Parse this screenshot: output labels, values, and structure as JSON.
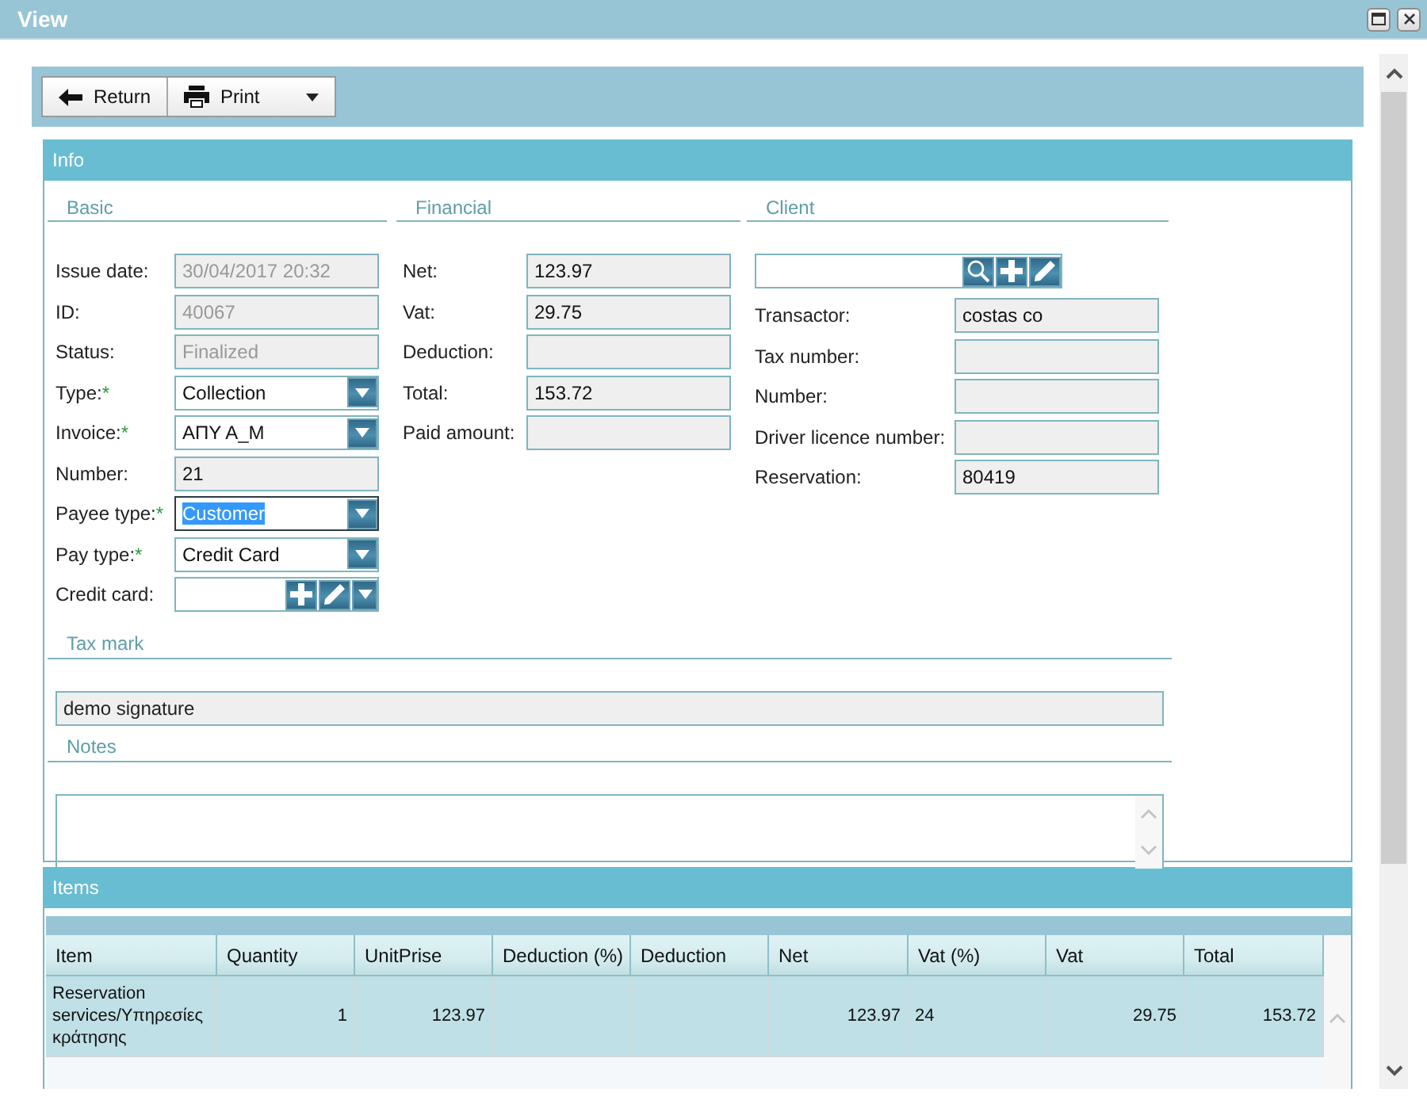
{
  "window": {
    "title": "View"
  },
  "toolbar": {
    "buttons": [
      {
        "label": "Return",
        "kind": "back",
        "menu": false
      },
      {
        "label": "Print",
        "kind": "print",
        "menu": true
      }
    ]
  },
  "info": {
    "title": "Info",
    "sections": [
      {
        "title": "Basic",
        "fields": [
          {
            "label": "Issue date:",
            "value": "30/04/2017 20:32",
            "kind": "text",
            "readonly": true,
            "disabled": true
          },
          {
            "label": "ID:",
            "value": "40067",
            "kind": "text",
            "readonly": true,
            "disabled": true
          },
          {
            "label": "Status:",
            "value": "Finalized",
            "kind": "text",
            "readonly": true,
            "disabled": true
          },
          {
            "label": "Type:",
            "required_mark": "*",
            "value": "Collection",
            "kind": "select",
            "readonly": false,
            "disabled": false
          },
          {
            "label": "Invoice:",
            "required_mark": "*",
            "value": "ΑΠΥ Α_Μ",
            "kind": "select",
            "readonly": false,
            "disabled": false
          },
          {
            "label": "Number:",
            "value": "21",
            "kind": "text",
            "readonly": true,
            "disabled": false
          },
          {
            "label": "Payee type:",
            "required_mark": "*",
            "value": "Customer",
            "kind": "select",
            "readonly": false,
            "disabled": false,
            "focused": true
          },
          {
            "label": "Pay type:",
            "required_mark": "*",
            "value": "Credit Card",
            "kind": "select",
            "readonly": false,
            "disabled": false
          },
          {
            "label": "Credit card:",
            "kind": "picker",
            "readonly": false
          }
        ]
      },
      {
        "title": "Financial",
        "fields": [
          {
            "label": "Net:",
            "value": "123.97",
            "kind": "text",
            "readonly": true,
            "disabled": false
          },
          {
            "label": "Vat:",
            "value": "29.75",
            "kind": "text",
            "readonly": true,
            "disabled": false
          },
          {
            "label": "Deduction:",
            "kind": "text",
            "readonly": true,
            "disabled": false
          },
          {
            "label": "Total:",
            "value": "153.72",
            "kind": "text",
            "readonly": true,
            "disabled": false
          },
          {
            "label": "Paid amount:",
            "kind": "text",
            "readonly": true,
            "disabled": false
          }
        ]
      },
      {
        "title": "Client",
        "fields": [
          {
            "kind": "search-picker",
            "readonly": false
          },
          {
            "label": "Transactor:",
            "value": "costas co",
            "kind": "text",
            "readonly": true,
            "disabled": false
          },
          {
            "label": "Tax number:",
            "kind": "text",
            "readonly": true,
            "disabled": false
          },
          {
            "label": "Number:",
            "kind": "text",
            "readonly": true,
            "disabled": false
          },
          {
            "label": "Driver licence number:",
            "kind": "text",
            "readonly": true,
            "disabled": false
          },
          {
            "label": "Reservation:",
            "value": "80419",
            "kind": "text",
            "readonly": true,
            "disabled": false
          }
        ]
      }
    ],
    "tax_mark": {
      "title": "Tax mark",
      "value": "demo signature"
    },
    "notes": {
      "title": "Notes"
    }
  },
  "items": {
    "title": "Items",
    "columns": [
      {
        "label": "Item"
      },
      {
        "label": "Quantity",
        "kind": "number"
      },
      {
        "label": "UnitPrise",
        "kind": "number"
      },
      {
        "label": "Deduction (%)"
      },
      {
        "label": "Deduction"
      },
      {
        "label": "Net",
        "kind": "number"
      },
      {
        "label": "Vat (%)"
      },
      {
        "label": "Vat",
        "kind": "number"
      },
      {
        "label": "Total",
        "kind": "number"
      }
    ],
    "rows": [
      {
        "selected": true,
        "cells": [
          "Reservation services/Υπηρεσίες κράτησης",
          "1",
          "123.97",
          "",
          "",
          "123.97",
          "24",
          "29.75",
          "153.72"
        ]
      }
    ]
  }
}
